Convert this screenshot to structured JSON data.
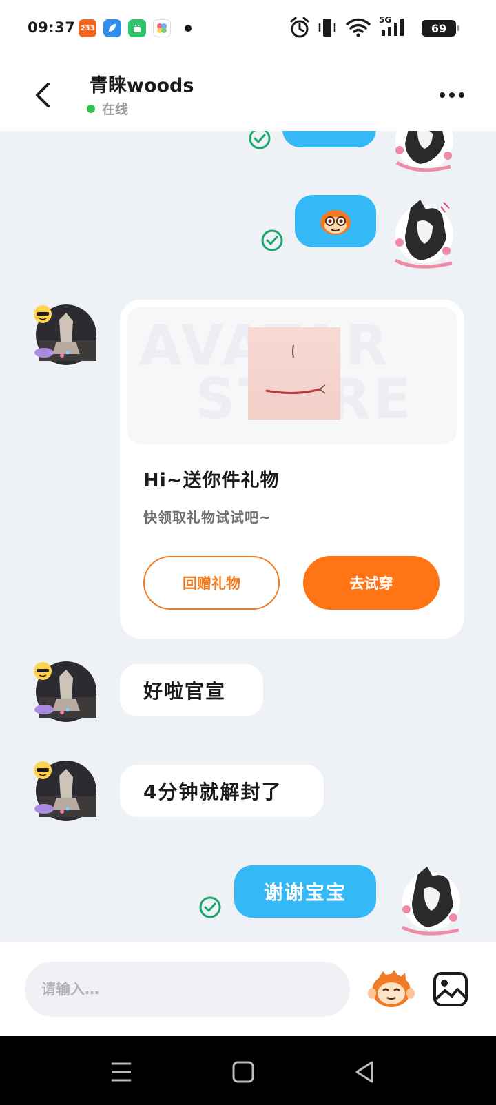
{
  "status_bar": {
    "time": "09:37",
    "apps": [
      {
        "name": "233-app-icon",
        "label": "233",
        "color": "#f2641f"
      },
      {
        "name": "feather-app-icon",
        "label": "",
        "color": "#2f8fe8"
      },
      {
        "name": "android-app-icon",
        "label": "",
        "color": "#2dc26b"
      },
      {
        "name": "clover-app-icon",
        "label": "",
        "color": "#ffffff"
      }
    ],
    "network": "5G",
    "battery": "69"
  },
  "header": {
    "contact_name": "青睐woods",
    "status": "在线"
  },
  "messages": [
    {
      "from": "me",
      "text": "",
      "type": "partial-bubble"
    },
    {
      "from": "me",
      "text": "",
      "type": "emoji-sticker"
    },
    {
      "from": "other",
      "type": "gift-card"
    },
    {
      "from": "other",
      "text": "好啦官宣"
    },
    {
      "from": "other",
      "text": "4分钟就解封了"
    },
    {
      "from": "me",
      "text": "谢谢宝宝"
    }
  ],
  "gift_card": {
    "watermark_top": "AVATAR",
    "watermark_bottom": "STORE",
    "title": "Hi~送你件礼物",
    "subtitle": "快领取礼物试试吧~",
    "return_button": "回赠礼物",
    "try_button": "去试穿"
  },
  "chat_text": {
    "msg_other_1": "好啦官宣",
    "msg_other_2": "4分钟就解封了",
    "msg_me_3": "谢谢宝宝"
  },
  "input": {
    "placeholder": "请输入…"
  },
  "colors": {
    "my_bubble": "#35b8f6",
    "accent_orange": "#ff7414",
    "online_green": "#2fc34d",
    "read_check": "#1aa86a"
  }
}
